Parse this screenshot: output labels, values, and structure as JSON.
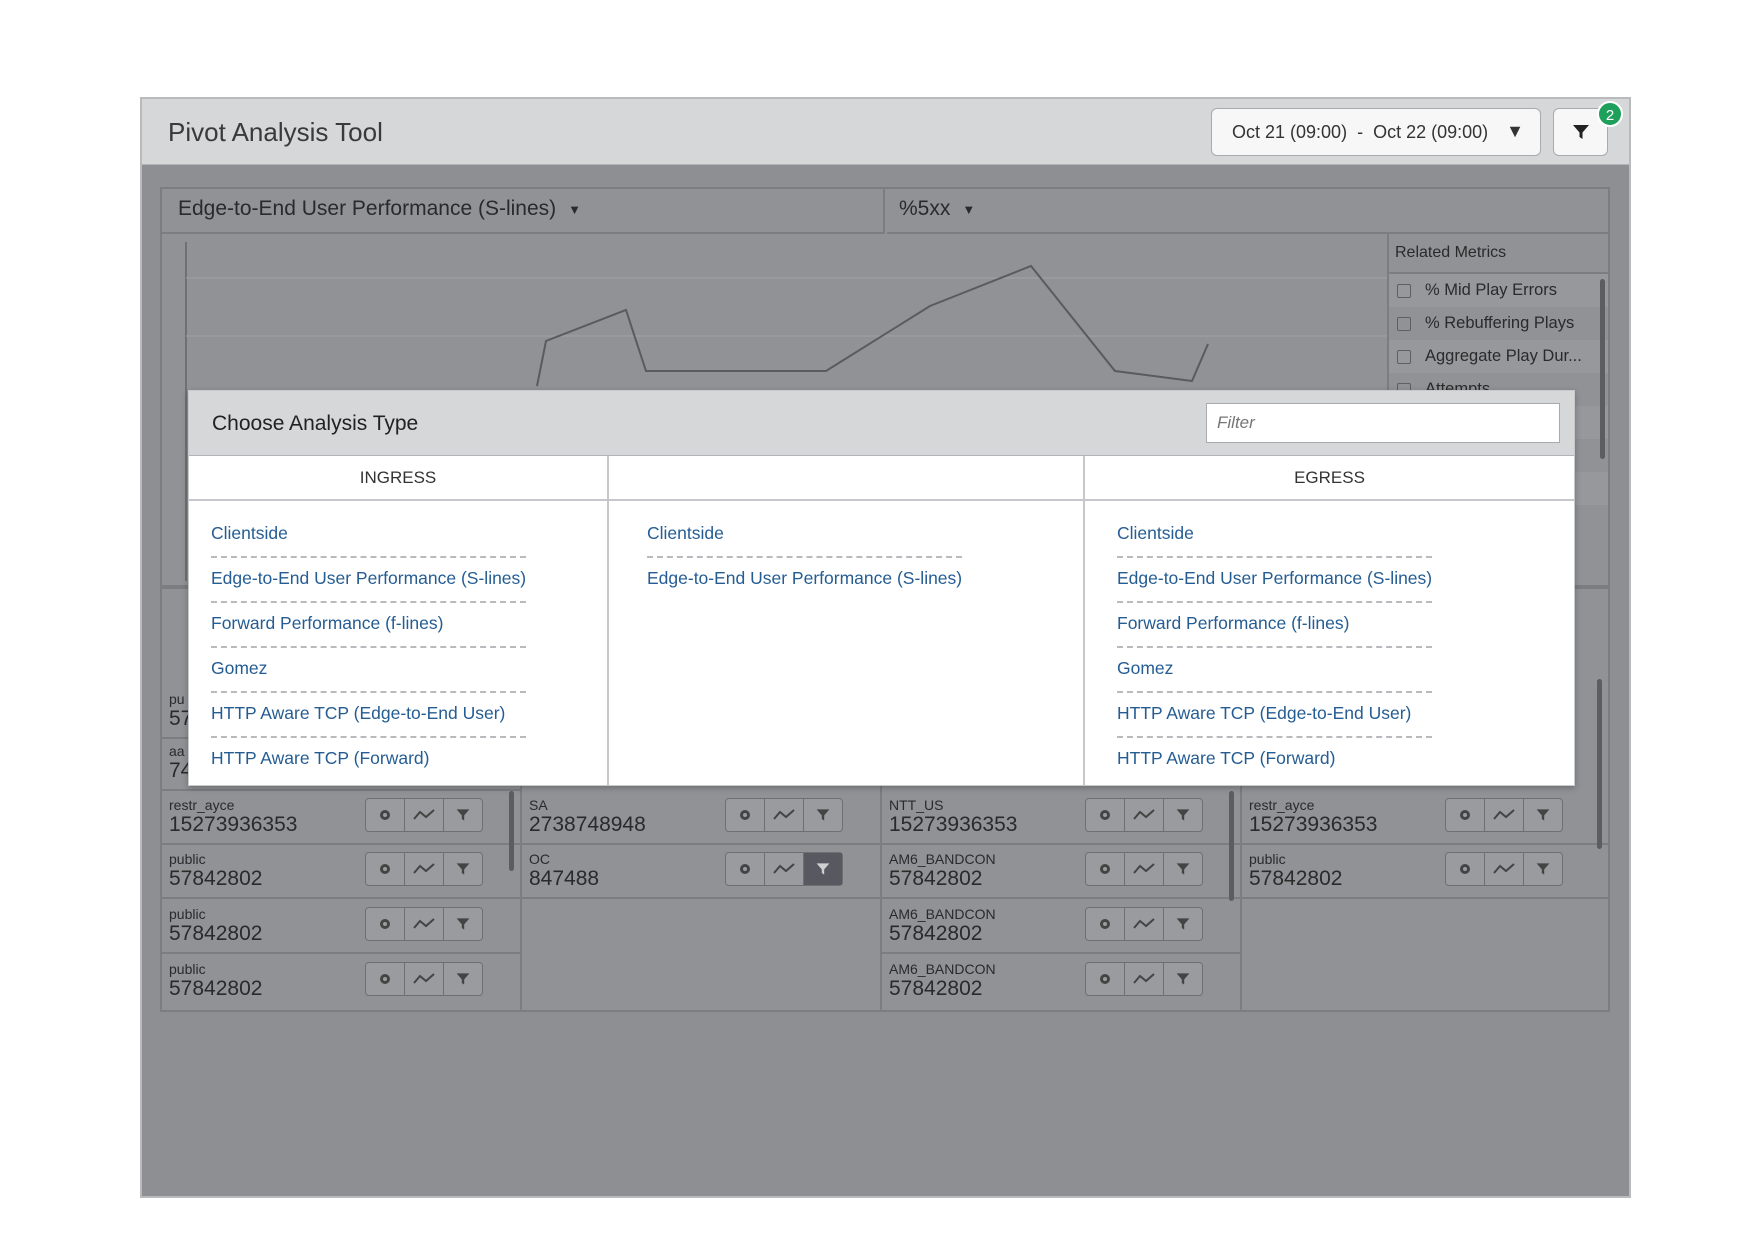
{
  "app": {
    "title": "Pivot Analysis Tool",
    "date_range": {
      "start": "Oct 21 (09:00)",
      "separator": "-",
      "end": "Oct 22 (09:00)"
    },
    "filter_count": "2"
  },
  "dropdowns": {
    "metric": "Edge-to-End User Performance (S-lines)",
    "stat": "%5xx"
  },
  "related_metrics": {
    "title": "Related Metrics",
    "items": [
      "% Mid Play Errors",
      "% Rebuffering Plays",
      "Aggregate Play Dur...",
      "Attempts"
    ]
  },
  "columns": [
    {
      "rows": [
        {
          "label": "pu",
          "value": "57",
          "active": false
        },
        {
          "label": "aa",
          "value": "74",
          "active": false
        },
        {
          "label": "restr_ayce",
          "value": "15273936353",
          "active": false
        },
        {
          "label": "public",
          "value": "57842802",
          "active": false
        },
        {
          "label": "public",
          "value": "57842802",
          "active": false
        },
        {
          "label": "public",
          "value": "57842802",
          "active": false
        }
      ]
    },
    {
      "rows": [
        {
          "label": "SA",
          "value": "2738748948",
          "active": false
        },
        {
          "label": "OC",
          "value": "847488",
          "active": true
        }
      ]
    },
    {
      "rows": [
        {
          "label": "NTT_US",
          "value": "15273936353",
          "active": false
        },
        {
          "label": "AM6_BANDCON",
          "value": "57842802",
          "active": false
        },
        {
          "label": "AM6_BANDCON",
          "value": "57842802",
          "active": false
        },
        {
          "label": "AM6_BANDCON",
          "value": "57842802",
          "active": false
        }
      ]
    },
    {
      "rows": [
        {
          "label": "restr_ayce",
          "value": "15273936353",
          "active": false
        },
        {
          "label": "public",
          "value": "57842802",
          "active": false
        }
      ]
    }
  ],
  "modal": {
    "title": "Choose Analysis Type",
    "filter_placeholder": "Filter",
    "columns": [
      {
        "header": "INGRESS",
        "items": [
          "Clientside",
          "Edge-to-End User Performance (S-lines)",
          "Forward Performance (f-lines)",
          "Gomez",
          "HTTP Aware TCP (Edge-to-End User)",
          "HTTP Aware TCP (Forward)"
        ]
      },
      {
        "header": "",
        "items": [
          "Clientside",
          "Edge-to-End User Performance (S-lines)"
        ]
      },
      {
        "header": "EGRESS",
        "items": [
          "Clientside",
          "Edge-to-End User Performance (S-lines)",
          "Forward Performance (f-lines)",
          "Gomez",
          "HTTP Aware TCP (Edge-to-End User)",
          "HTTP Aware TCP (Forward)"
        ]
      }
    ]
  },
  "icons": {
    "filter": "filter-icon",
    "caret": "caret-down-icon",
    "gear": "gear-icon",
    "trend": "trend-icon",
    "checkbox": "checkbox-icon"
  },
  "colors": {
    "overlay": "#8e8f93",
    "link": "#255d93",
    "badge": "#1ea05b",
    "header": "#d6d7d9"
  }
}
